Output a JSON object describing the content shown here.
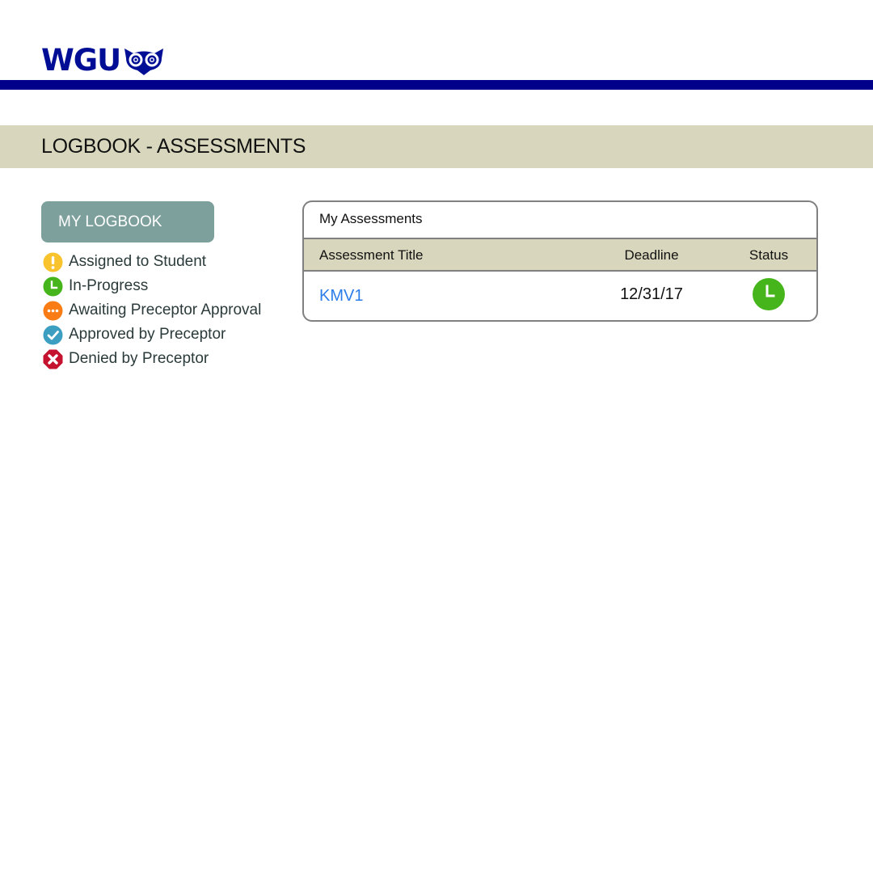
{
  "header": {
    "logo_text": "WGU",
    "brand_color": "#000e96",
    "rule_color": "#00008b"
  },
  "title_band": {
    "title": "LOGBOOK - ASSESSMENTS",
    "background": "#d8d7bd"
  },
  "sidebar": {
    "logbook_button": {
      "label": "MY LOGBOOK",
      "background": "#7da09d"
    },
    "legend": [
      {
        "label": "Assigned to Student",
        "icon": "exclamation-icon",
        "color": "#f9c32d"
      },
      {
        "label": "In-Progress",
        "icon": "clock-icon",
        "color": "#45b51b"
      },
      {
        "label": "Awaiting Preceptor Approval",
        "icon": "ellipsis-icon",
        "color": "#f97d14"
      },
      {
        "label": "Approved by Preceptor",
        "icon": "checkmark-icon",
        "color": "#3c9fc2"
      },
      {
        "label": "Denied by Preceptor",
        "icon": "x-octagon-icon",
        "color": "#c4122f"
      }
    ]
  },
  "assessments": {
    "title": "My Assessments",
    "columns": {
      "title": "Assessment Title",
      "deadline": "Deadline",
      "status": "Status"
    },
    "header_background": "#d8d7bd",
    "link_color": "#2b7de9",
    "rows": [
      {
        "title": "KMV1",
        "deadline": "12/31/17",
        "status": "In-Progress",
        "status_icon": "clock-icon",
        "status_color": "#45b51b"
      }
    ]
  }
}
